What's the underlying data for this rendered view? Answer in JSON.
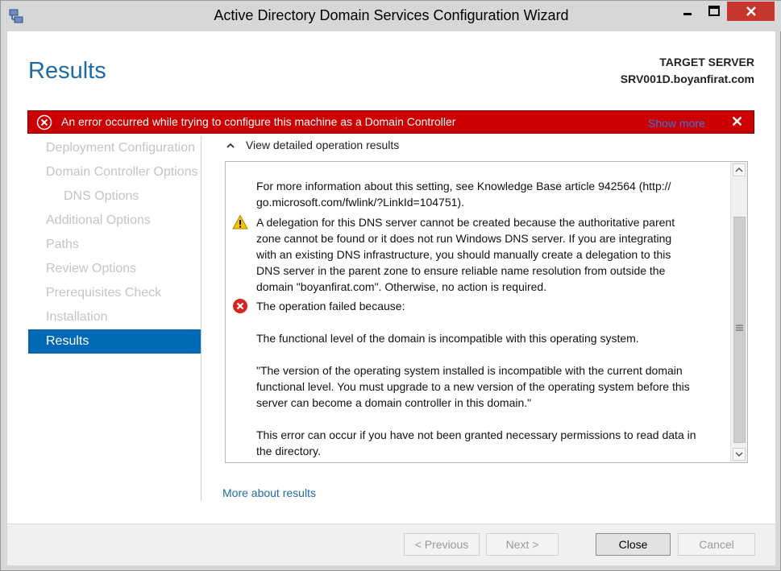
{
  "window": {
    "title": "Active Directory Domain Services Configuration Wizard",
    "minimize_glyph": "—",
    "maximize_glyph": "□",
    "close_glyph": "✕"
  },
  "header": {
    "page_title": "Results",
    "target_label": "TARGET SERVER",
    "target_name": "SRV001D.boyanfirat.com"
  },
  "error_bar": {
    "message": "An error occurred while trying to configure this machine as a Domain Controller",
    "show_more": "Show more",
    "close_glyph": "✕",
    "color": "#cc0000"
  },
  "nav": {
    "items": [
      {
        "label": "Deployment Configuration",
        "sub": false,
        "active": false
      },
      {
        "label": "Domain Controller Options",
        "sub": false,
        "active": false
      },
      {
        "label": "DNS Options",
        "sub": true,
        "active": false
      },
      {
        "label": "Additional Options",
        "sub": false,
        "active": false
      },
      {
        "label": "Paths",
        "sub": false,
        "active": false
      },
      {
        "label": "Review Options",
        "sub": false,
        "active": false
      },
      {
        "label": "Prerequisites Check",
        "sub": false,
        "active": false
      },
      {
        "label": "Installation",
        "sub": false,
        "active": false
      },
      {
        "label": "Results",
        "sub": false,
        "active": true
      }
    ],
    "active_color": "#0069b5"
  },
  "details": {
    "toggle_label": "View detailed operation results",
    "messages": [
      {
        "icon": "none",
        "text": "For more information about this setting, see Knowledge Base article 942564 (http://\ngo.microsoft.com/fwlink/?LinkId=104751)."
      },
      {
        "icon": "warning-icon",
        "text": "A delegation for this DNS server cannot be created because the authoritative parent\nzone cannot be found or it does not run Windows DNS server. If you are integrating\nwith an existing DNS infrastructure, you should manually create a delegation to this\nDNS server in the parent zone to ensure reliable name resolution from outside the\ndomain \"boyanfirat.com\". Otherwise, no action is required."
      },
      {
        "icon": "error-icon",
        "text": "The operation failed because:"
      },
      {
        "icon": "none",
        "text": "The functional level of the domain is incompatible with this operating system."
      },
      {
        "icon": "none",
        "text": "\"The version of the operating system installed is incompatible with the current domain\nfunctional level. You must upgrade to a new version of the operating system before this\nserver can become a domain controller in this domain.\""
      },
      {
        "icon": "none",
        "text": "This error can occur if you have not been granted necessary permissions to read data in\nthe directory."
      }
    ]
  },
  "links": {
    "more_about_results": "More about results"
  },
  "footer": {
    "previous": "< Previous",
    "next": "Next >",
    "close": "Close",
    "cancel": "Cancel"
  }
}
